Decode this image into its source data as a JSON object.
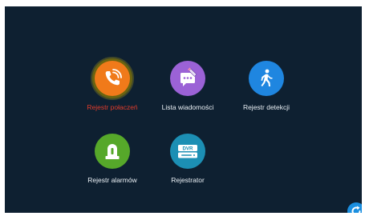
{
  "menu": {
    "items": [
      {
        "label": "Rejestr połaczeń",
        "icon": "phone-call-icon",
        "color": "#f07a1a",
        "active": true
      },
      {
        "label": "Lista wiadomości",
        "icon": "message-edit-icon",
        "color": "#9b62d6",
        "active": false
      },
      {
        "label": "Rejestr detekcji",
        "icon": "walking-person-icon",
        "color": "#1f86e0",
        "active": false
      },
      {
        "label": "Rejestr alarmów",
        "icon": "alarm-light-icon",
        "color": "#56a82a",
        "active": false
      },
      {
        "label": "Rejestrator",
        "icon": "dvr-icon",
        "color": "#1c8fb4",
        "active": false,
        "badge": "DVR"
      }
    ]
  },
  "refresh_button": {
    "icon": "refresh-icon",
    "color": "#1b8fe0"
  },
  "colors": {
    "background": "#0e2031",
    "active_label": "#e23c2c",
    "label": "#eaf0f5"
  }
}
